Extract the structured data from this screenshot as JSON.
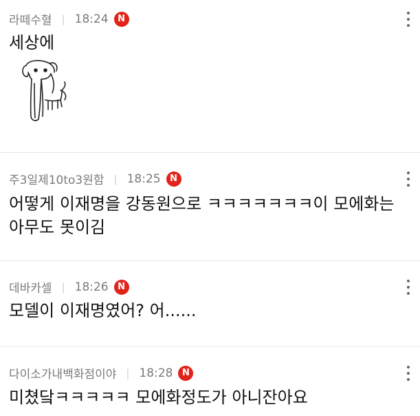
{
  "comments": [
    {
      "author": "라떼수혈",
      "time": "18:24",
      "badge": "N",
      "text": "세상에",
      "sticker": "dog-sticker-icon"
    },
    {
      "author": "주3일제10to3원함",
      "time": "18:25",
      "badge": "N",
      "text": "어떻게 이재명을 강동원으로 ㅋㅋㅋㅋㅋㅋㅋ이 모에화는 아무도 못이김"
    },
    {
      "author": "데바카셀",
      "time": "18:26",
      "badge": "N",
      "text": "모델이 이재명였어? 어......"
    },
    {
      "author": "다이소가내백화점이야",
      "time": "18:28",
      "badge": "N",
      "text": "미쳤닼ㅋㅋㅋㅋㅋ 모에화정도가 아니잔아요"
    }
  ],
  "separator": "|",
  "colors": {
    "badge": "#e2231a",
    "meta": "#7a7a7a",
    "divider": "#e6e6e6"
  }
}
